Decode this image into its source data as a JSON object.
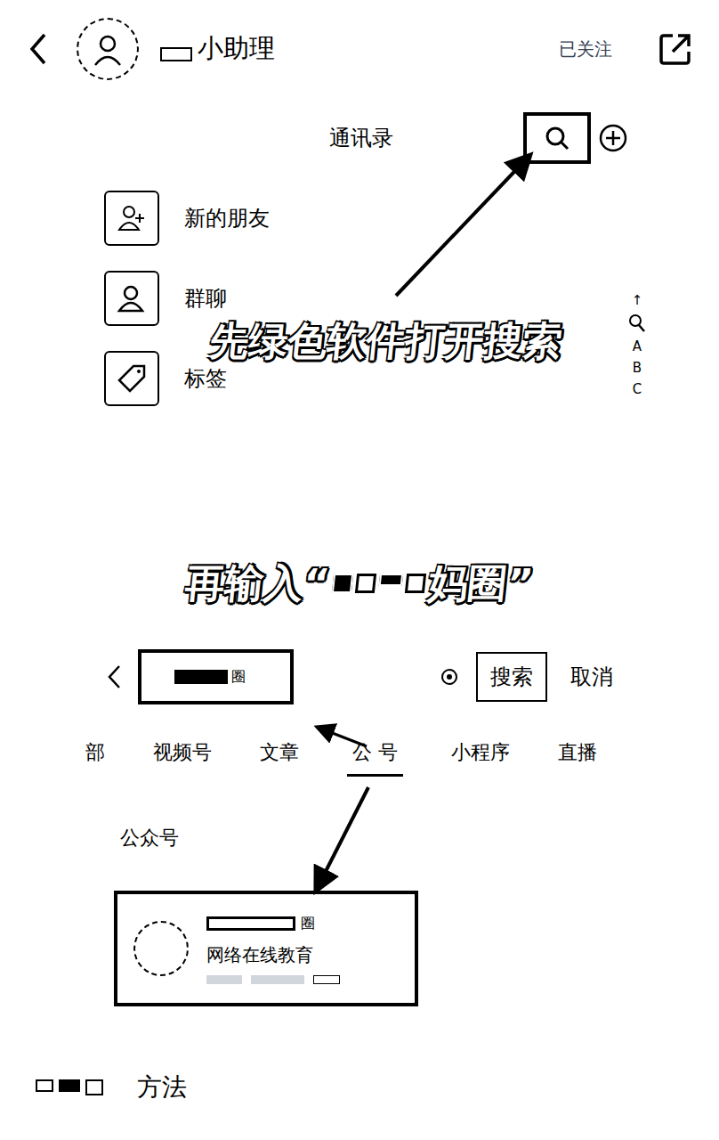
{
  "header": {
    "title": "小助理",
    "follow": "已关注"
  },
  "contacts": {
    "title": "通讯录",
    "items": [
      {
        "label": "新的朋友"
      },
      {
        "label": "群聊"
      },
      {
        "label": "标签"
      }
    ],
    "index": [
      "↑",
      "A",
      "B",
      "C"
    ]
  },
  "captions": {
    "first": "先绿色软件打开搜索",
    "second_prefix": "再输入“",
    "second_suffix": "妈圈”"
  },
  "search": {
    "query": "圈",
    "button": "搜索",
    "cancel": "取消"
  },
  "tabs": [
    {
      "label": "部",
      "selected": false
    },
    {
      "label": "视频号",
      "selected": false
    },
    {
      "label": "文章",
      "selected": false
    },
    {
      "label": "公 号",
      "selected": true
    },
    {
      "label": "小程序",
      "selected": false
    },
    {
      "label": "直播",
      "selected": false
    }
  ],
  "section": {
    "title": "公众号"
  },
  "result": {
    "name_suffix": "圈",
    "description": "网络在线教育"
  },
  "footer": {
    "text": "方法"
  }
}
